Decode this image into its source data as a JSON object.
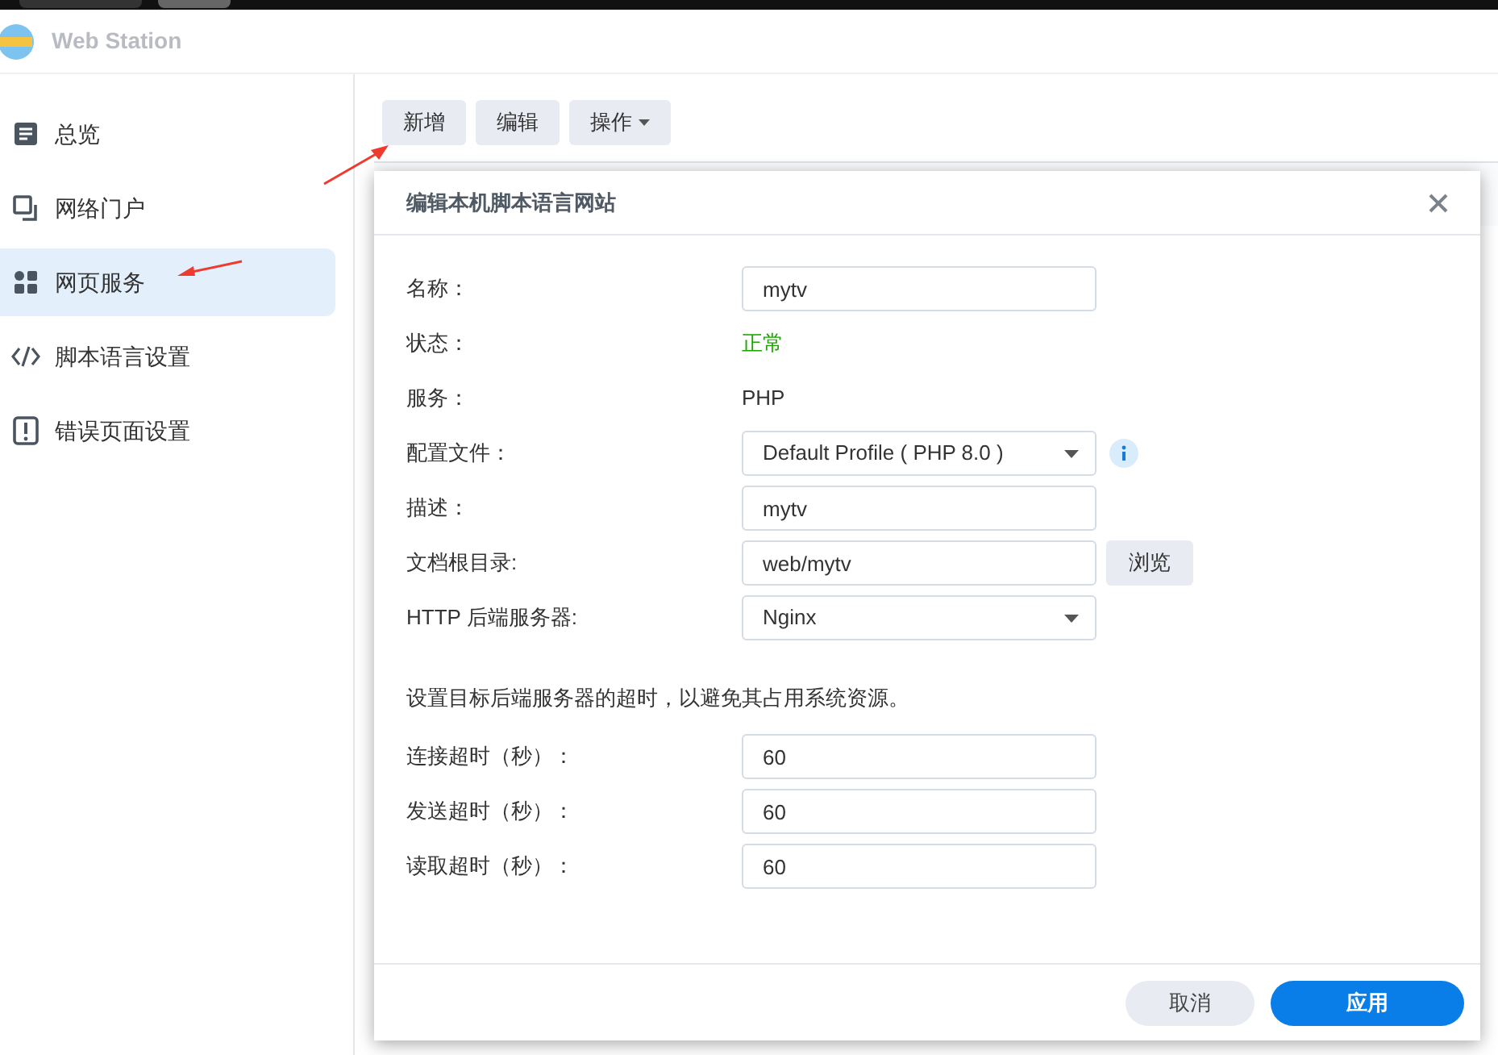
{
  "app": {
    "title": "Web Station"
  },
  "sidebar": {
    "items": [
      {
        "label": "总览",
        "kind": "overview",
        "selected": false
      },
      {
        "label": "网络门户",
        "kind": "portal",
        "selected": false
      },
      {
        "label": "网页服务",
        "kind": "services",
        "selected": true
      },
      {
        "label": "脚本语言设置",
        "kind": "code",
        "selected": false
      },
      {
        "label": "错误页面设置",
        "kind": "error",
        "selected": false
      }
    ]
  },
  "toolbar": [
    {
      "label": "新增",
      "dropdown": false
    },
    {
      "label": "编辑",
      "dropdown": false
    },
    {
      "label": "操作",
      "dropdown": true
    }
  ],
  "dialog": {
    "title": "编辑本机脚本语言网站",
    "fields": [
      {
        "kind": "input",
        "label": "名称：",
        "value": "mytv"
      },
      {
        "kind": "text",
        "label": "状态：",
        "value": "正常",
        "color": "#1ca600"
      },
      {
        "kind": "text",
        "label": "服务：",
        "value": "PHP"
      },
      {
        "kind": "select",
        "label": "配置文件：",
        "value": "Default Profile ( PHP 8.0 )",
        "info": true
      },
      {
        "kind": "input",
        "label": "描述：",
        "value": "mytv"
      },
      {
        "kind": "input",
        "label": "文档根目录:",
        "value": "web/mytv",
        "button": "浏览"
      },
      {
        "kind": "select",
        "label": "HTTP 后端服务器:",
        "value": "Nginx"
      },
      {
        "kind": "note",
        "label": "设置目标后端服务器的超时，以避免其占用系统资源。"
      },
      {
        "kind": "input",
        "label": "连接超时（秒）：",
        "value": "60"
      },
      {
        "kind": "input",
        "label": "发送超时（秒）：",
        "value": "60"
      },
      {
        "kind": "input",
        "label": "读取超时（秒）：",
        "value": "60"
      }
    ],
    "buttons": [
      {
        "label": "取消",
        "primary": false
      },
      {
        "label": "应用",
        "primary": true
      }
    ]
  },
  "annotations": [
    {
      "kind": "arrow"
    },
    {
      "kind": "arrow"
    }
  ]
}
